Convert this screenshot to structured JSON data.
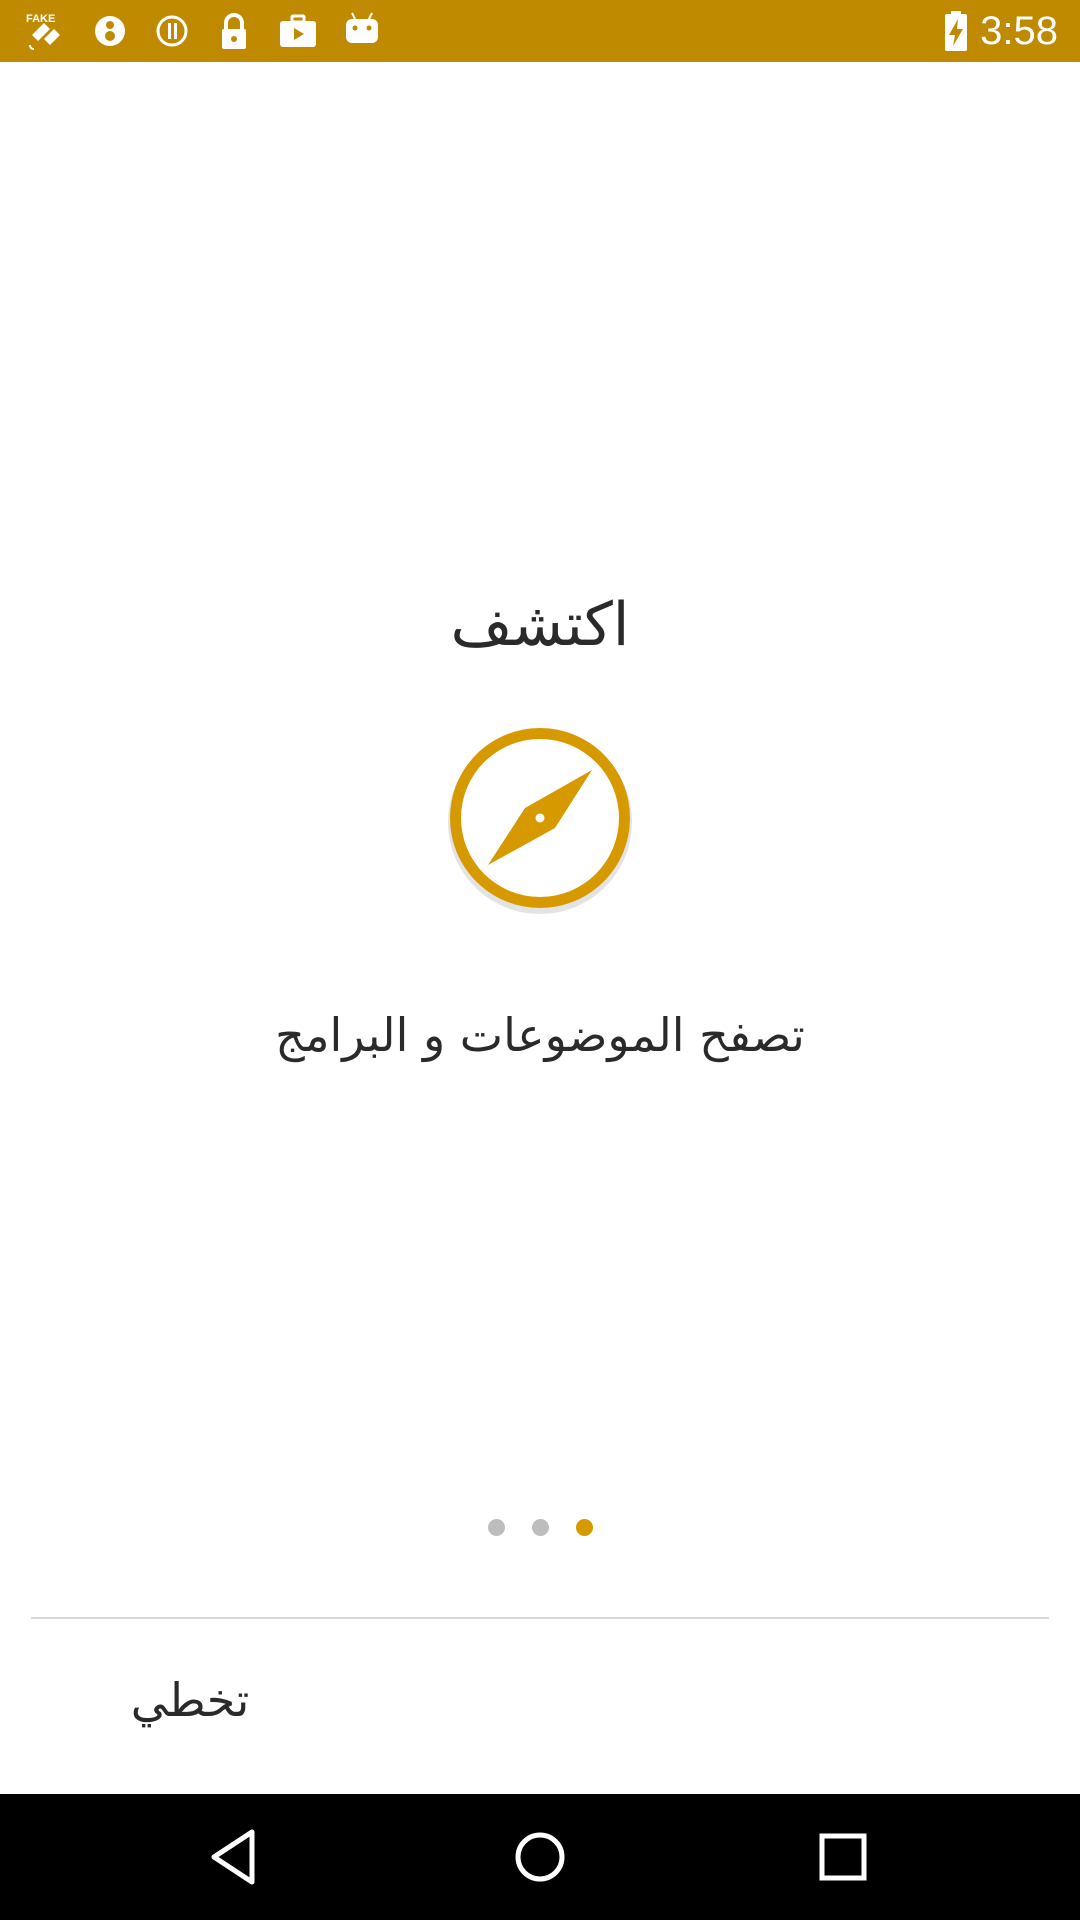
{
  "status_bar": {
    "time": "3:58",
    "background": "#bf8a00",
    "icons": [
      "fake-gps-icon",
      "notification-icon",
      "info-icon",
      "lock-icon",
      "briefcase-icon",
      "android-icon",
      "battery-charging-icon"
    ]
  },
  "onboarding": {
    "title": "اكتشف",
    "icon": "compass-icon",
    "subtitle": "تصفح الموضوعات و البرامج",
    "accent": "#d69a00",
    "page_count": 3,
    "active_page": 3
  },
  "footer": {
    "skip_label": "تخطي"
  },
  "nav_bar": {
    "buttons": [
      "back-icon",
      "home-icon",
      "recents-icon"
    ]
  }
}
